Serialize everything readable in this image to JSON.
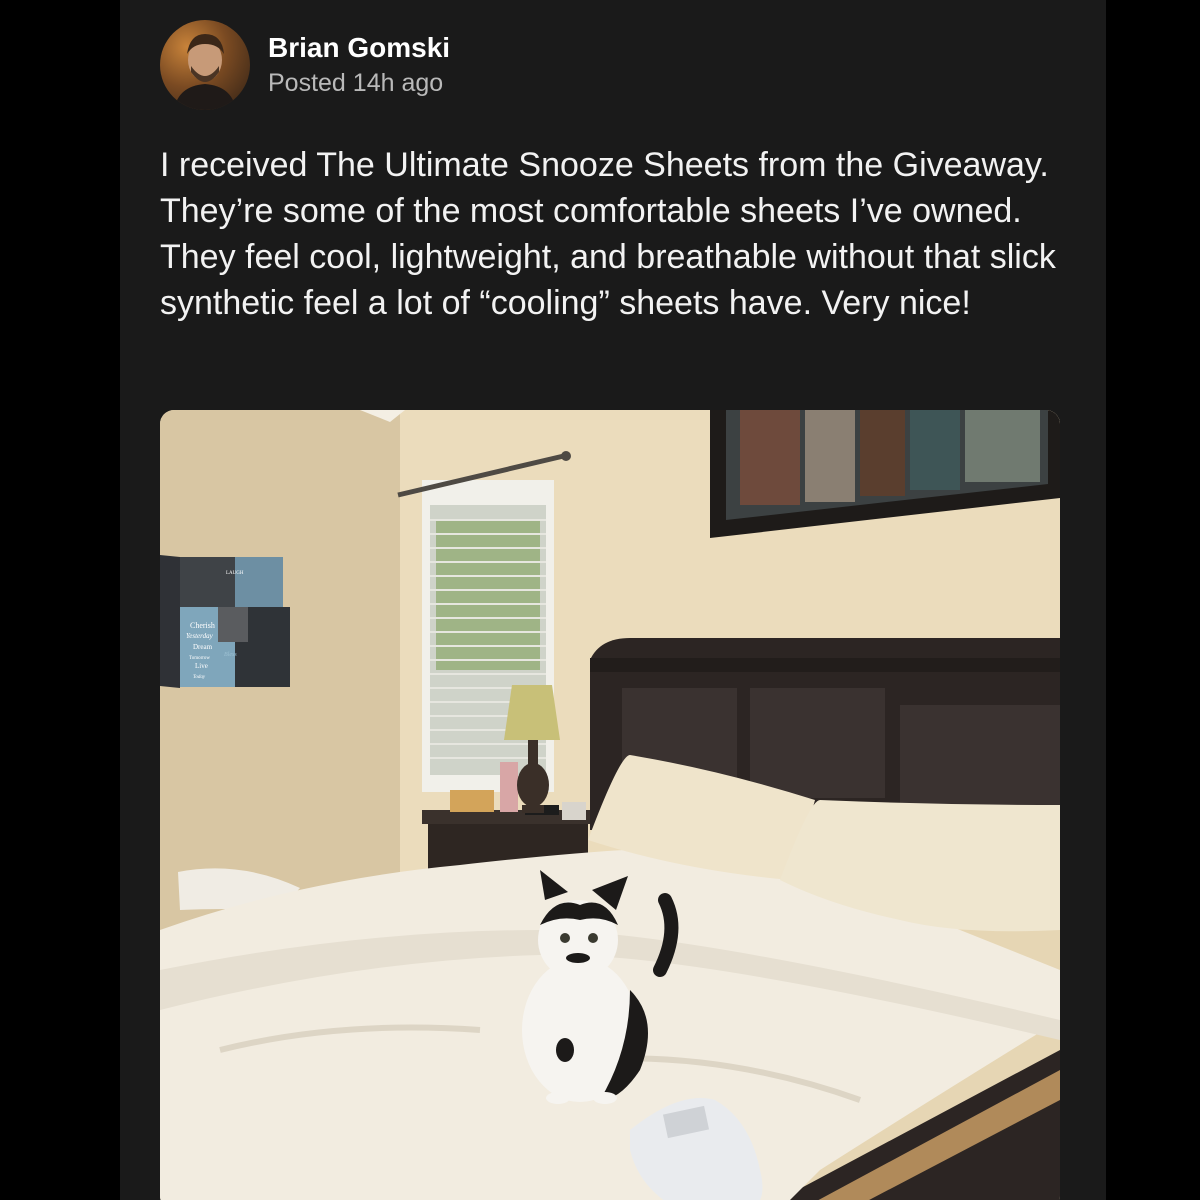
{
  "post": {
    "author": "Brian Gomski",
    "posted_prefix": "Posted",
    "posted_time": "14h ago",
    "body": "I received The Ultimate Snooze Sheets from the Giveaway. They’re some of the most comfortable sheets I’ve owned. They feel cool, lightweight, and breathable without that slick synthetic feel a lot of “cooling” sheets have. Very nice!"
  },
  "photo": {
    "canvas_words": [
      "Cherish",
      "Yesterday",
      "Dream",
      "Tomorrow",
      "Live",
      "Today"
    ],
    "canvas_side_word": "LAUGH",
    "canvas_bless_word": "Bless"
  },
  "icons": {
    "avatar": "person-photo",
    "photo": "bedroom-with-cat-photo"
  },
  "colors": {
    "background": "#000000",
    "card": "#1a1a1a",
    "text_primary": "#ffffff",
    "text_secondary": "#b9b9b9"
  }
}
